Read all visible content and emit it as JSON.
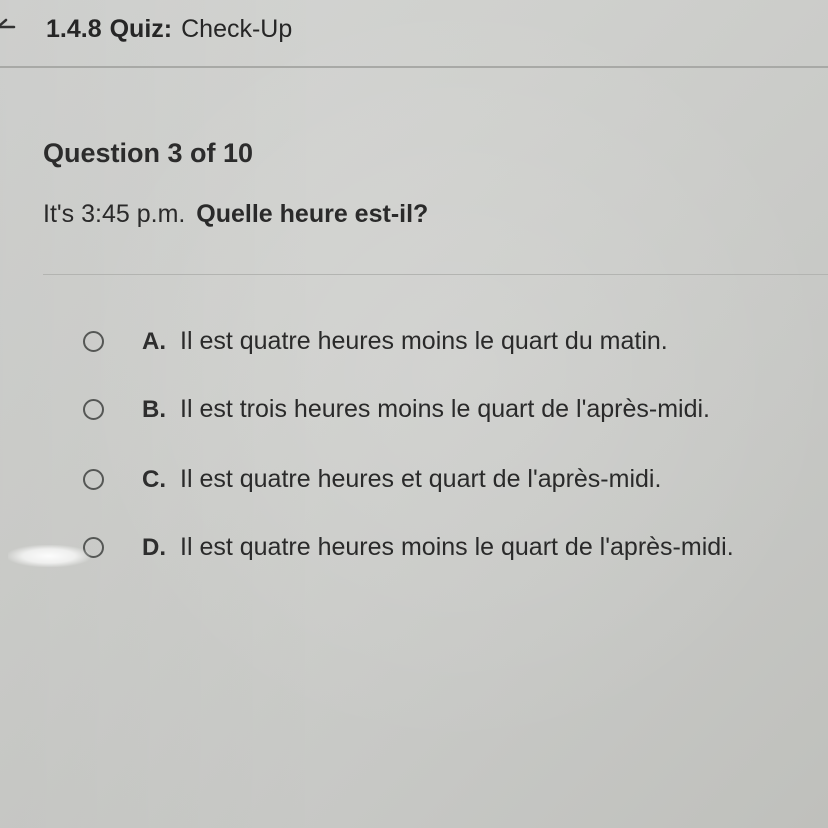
{
  "header": {
    "quiz_code": "1.4.8",
    "quiz_kind": "Quiz:",
    "quiz_name": "Check-Up",
    "back_icon": "back-arrow-icon"
  },
  "question": {
    "counter": "Question 3 of 10",
    "prompt_plain": "It's 3:45 p.m.",
    "prompt_bold": "Quelle heure est-il?"
  },
  "options": [
    {
      "letter": "A.",
      "text": "Il est quatre heures moins le quart du matin.",
      "selected": false
    },
    {
      "letter": "B.",
      "text": "Il est trois heures moins le quart de l'après-midi.",
      "selected": false
    },
    {
      "letter": "C.",
      "text": "Il est quatre heures et quart de l'après-midi.",
      "selected": false
    },
    {
      "letter": "D.",
      "text": "Il est quatre heures moins le quart de l'après-midi.",
      "selected": false
    }
  ],
  "colors": {
    "background": "#cfd0cd",
    "text": "#2a2a2a",
    "divider": "#a8a9a6",
    "radio_border": "#555755"
  }
}
